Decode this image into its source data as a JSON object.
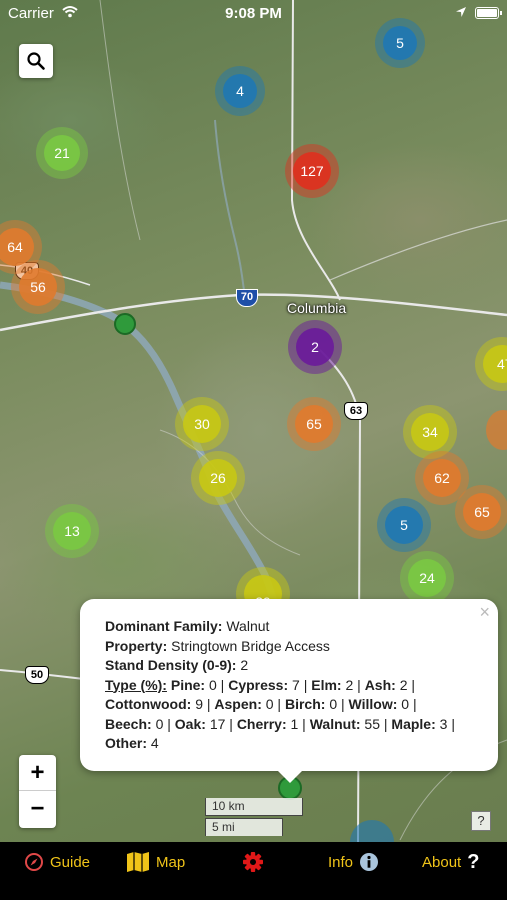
{
  "status_bar": {
    "carrier": "Carrier",
    "time": "9:08 PM"
  },
  "map": {
    "city_label": "Columbia",
    "shields": {
      "interstate": "70",
      "us63": "63",
      "us40": "40",
      "us50": "50"
    },
    "clusters": [
      {
        "count": "5",
        "color": "#1f78b4"
      },
      {
        "count": "4",
        "color": "#1f78b4"
      },
      {
        "count": "21",
        "color": "#7ac943"
      },
      {
        "count": "127",
        "color": "#e0301e"
      },
      {
        "count": "64",
        "color": "#e07a2e"
      },
      {
        "count": "56",
        "color": "#e07a2e"
      },
      {
        "count": "2",
        "color": "#6a1b9a"
      },
      {
        "count": "65",
        "color": "#e07a2e"
      },
      {
        "count": "30",
        "color": "#c8c814"
      },
      {
        "count": "34",
        "color": "#c8c814"
      },
      {
        "count": "26",
        "color": "#c8c814"
      },
      {
        "count": "62",
        "color": "#e07a2e"
      },
      {
        "count": "13",
        "color": "#7ac943"
      },
      {
        "count": "5",
        "color": "#1f78b4"
      },
      {
        "count": "65",
        "color": "#e07a2e"
      },
      {
        "count": "24",
        "color": "#7ac943"
      },
      {
        "count": "29",
        "color": "#c8c814"
      },
      {
        "count": "47",
        "color": "#c8c814"
      }
    ],
    "scale": {
      "km": "10 km",
      "mi": "5 mi"
    },
    "help_label": "?"
  },
  "popup": {
    "dominant_family_label": "Dominant Family:",
    "dominant_family_value": "Walnut",
    "property_label": "Property:",
    "property_value": "Stringtown Bridge Access",
    "density_label": "Stand Density (0-9):",
    "density_value": "2",
    "type_label": "Type (%):",
    "types": [
      {
        "name": "Pine:",
        "value": "0"
      },
      {
        "name": "Cypress:",
        "value": "7"
      },
      {
        "name": "Elm:",
        "value": "2"
      },
      {
        "name": "Ash:",
        "value": "2"
      },
      {
        "name": "Cottonwood:",
        "value": "9"
      },
      {
        "name": "Aspen:",
        "value": "0"
      },
      {
        "name": "Birch:",
        "value": "0"
      },
      {
        "name": "Willow:",
        "value": "0"
      },
      {
        "name": "Beech:",
        "value": "0"
      },
      {
        "name": "Oak:",
        "value": "17"
      },
      {
        "name": "Cherry:",
        "value": "1"
      },
      {
        "name": "Walnut:",
        "value": "55"
      },
      {
        "name": "Maple:",
        "value": "3"
      },
      {
        "name": "Other:",
        "value": "4"
      }
    ],
    "close": "×"
  },
  "zoom": {
    "in": "+",
    "out": "−"
  },
  "tabbar": {
    "accent": "#f0c419",
    "settings_color": "#e01818",
    "items": [
      {
        "label": "Guide",
        "icon": "compass-icon"
      },
      {
        "label": "Map",
        "icon": "map-icon"
      },
      {
        "label": "",
        "icon": "gear-icon"
      },
      {
        "label": "Info",
        "icon": "info-icon"
      },
      {
        "label": "About",
        "icon": "question-icon"
      }
    ]
  }
}
